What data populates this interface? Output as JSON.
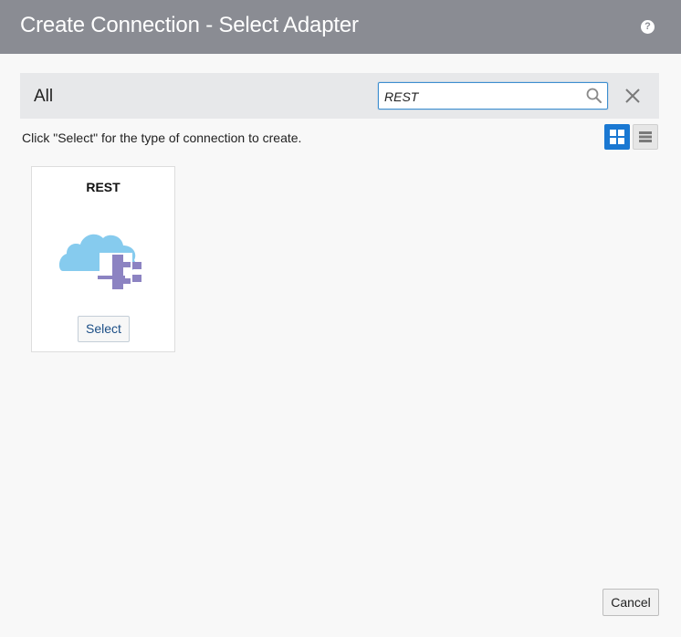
{
  "dialog": {
    "title": "Create Connection - Select Adapter",
    "help_icon": "question-mark-icon",
    "help_glyph": "?"
  },
  "filter": {
    "category_label": "All",
    "search_value": "REST",
    "search_icon": "magnifier-icon",
    "clear_icon": "close-x-icon"
  },
  "instruction": "Click \"Select\" for the type of connection to create.",
  "view_toggle": {
    "grid_icon": "grid-view-icon",
    "list_icon": "list-view-icon",
    "active": "grid"
  },
  "adapters": [
    {
      "name": "REST",
      "icon": "cloud-plug-icon",
      "select_label": "Select"
    }
  ],
  "footer": {
    "cancel_label": "Cancel"
  },
  "colors": {
    "titlebar": "#8a8c93",
    "accent": "#1a78d2",
    "cloud": "#86cbee",
    "plug": "#8c83c2"
  }
}
